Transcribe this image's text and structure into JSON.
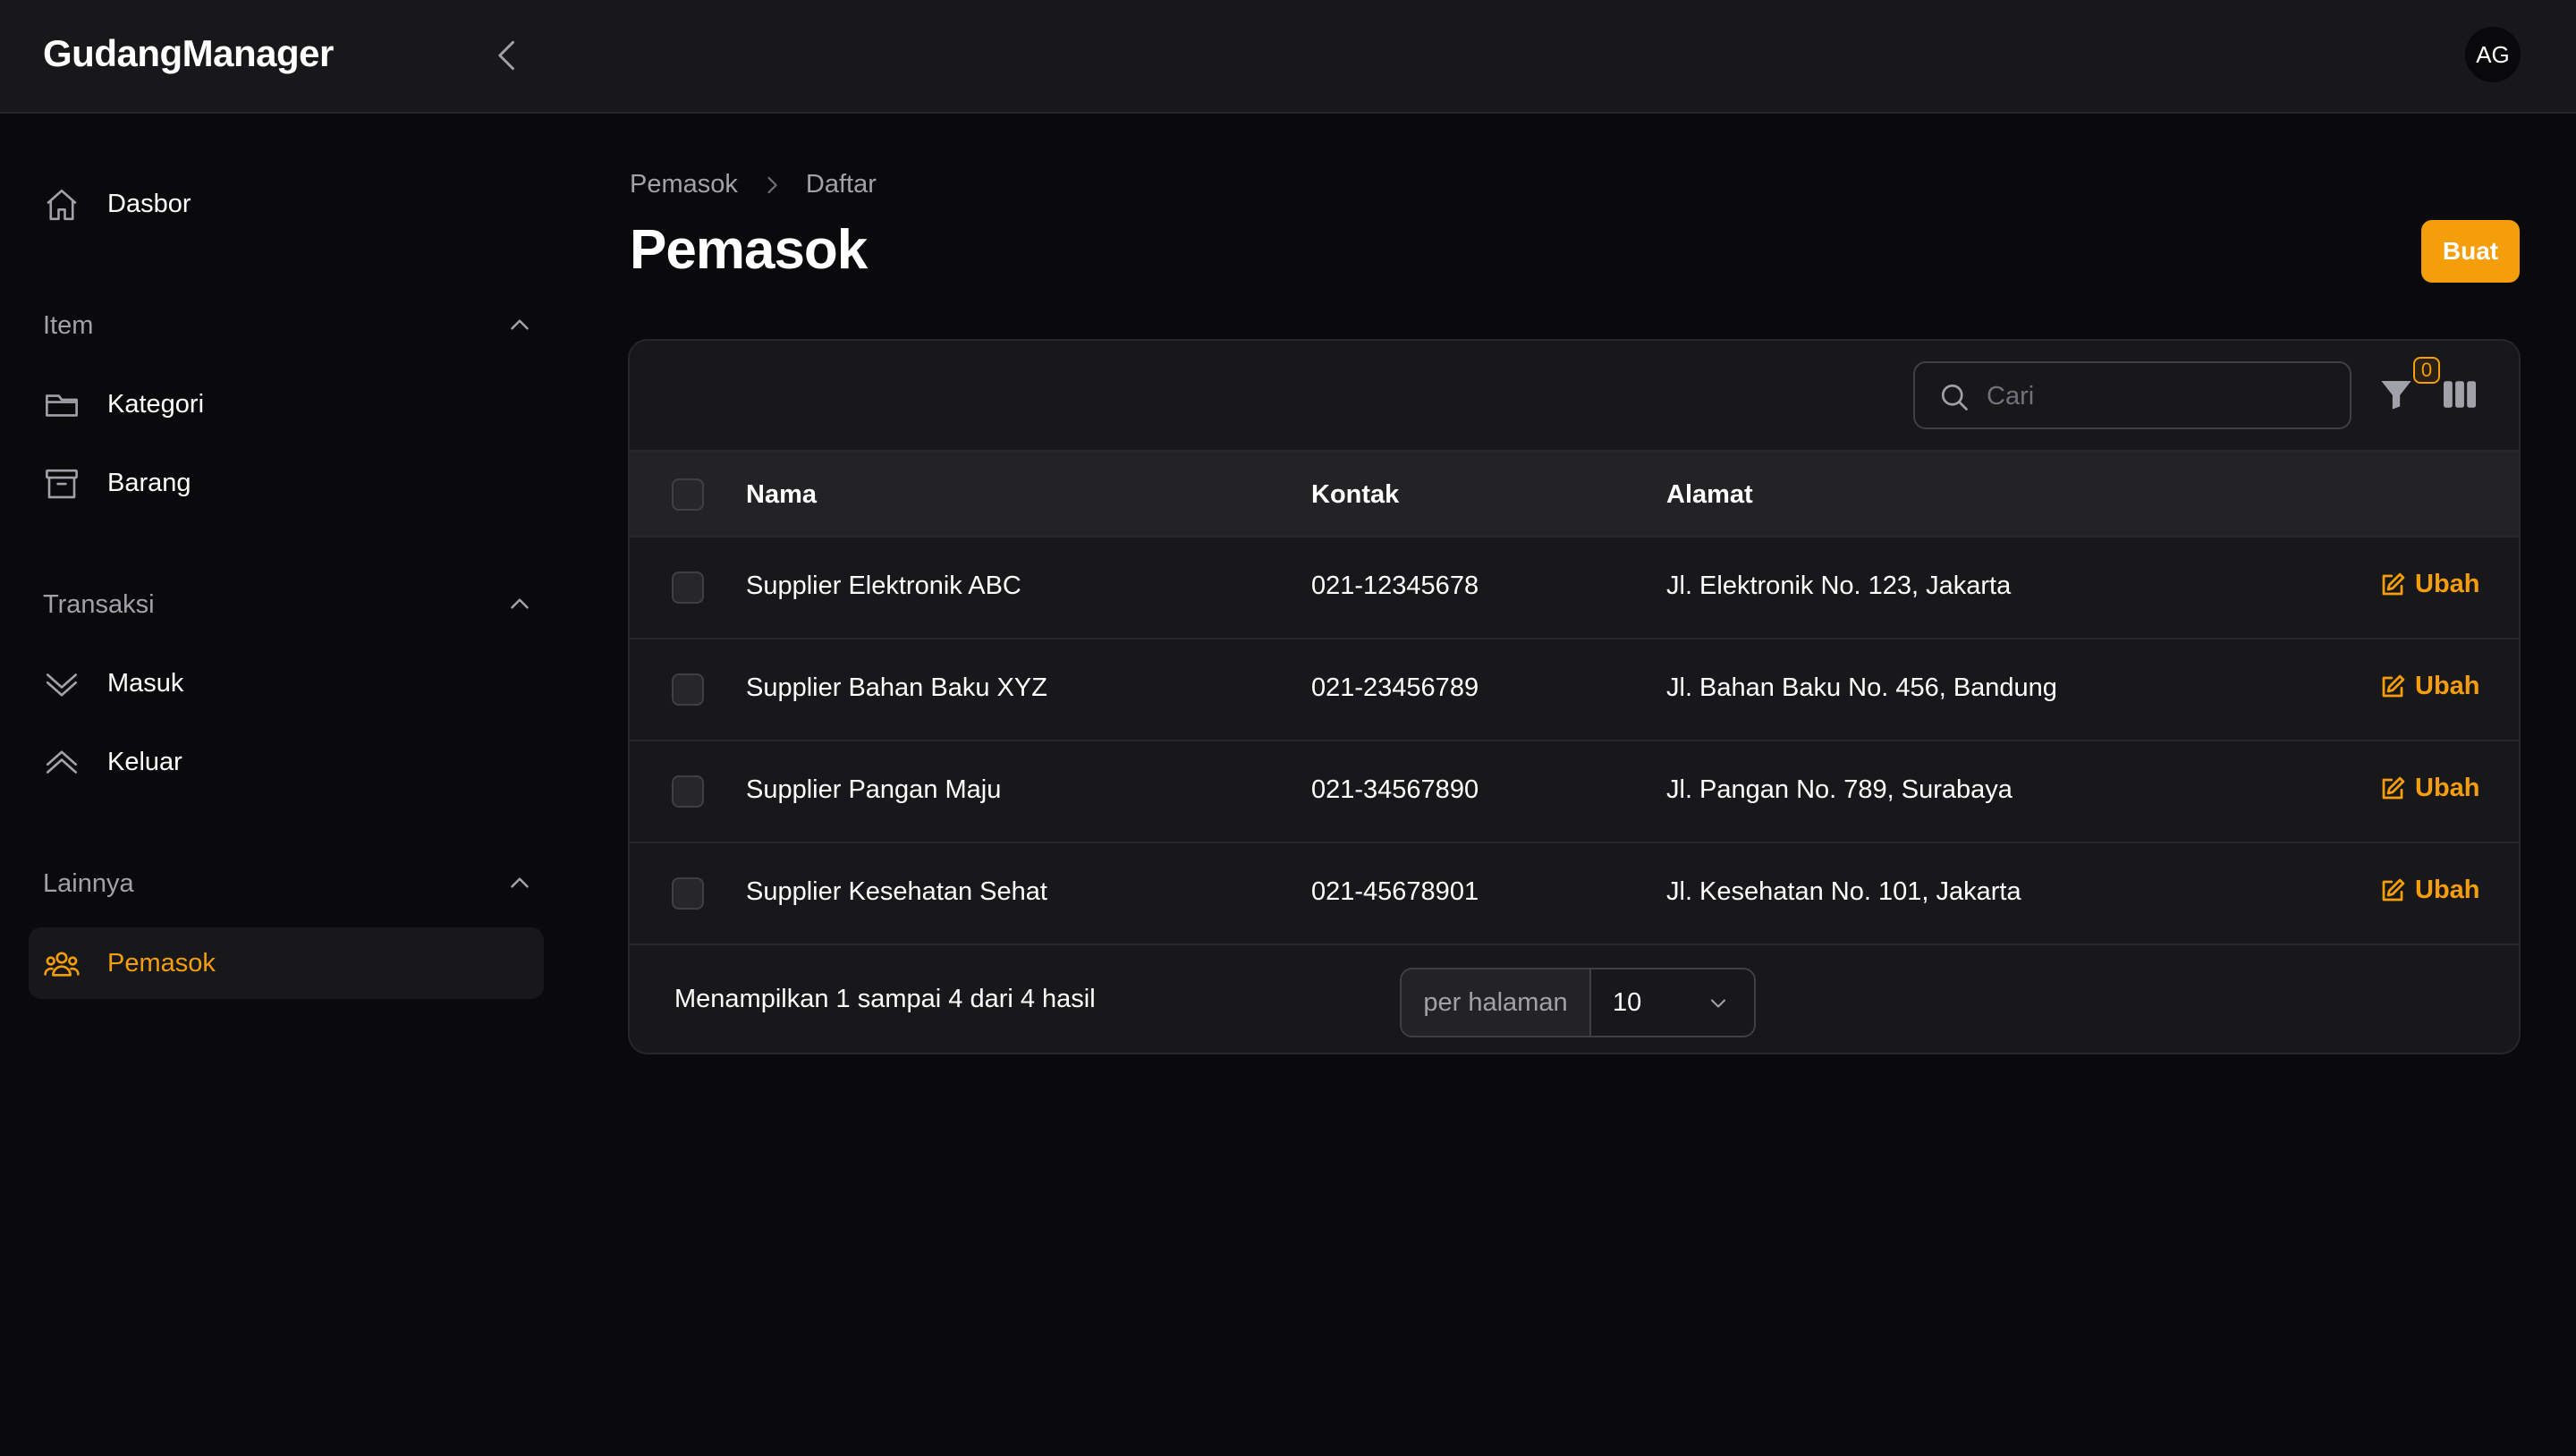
{
  "app": {
    "brand": "GudangManager",
    "avatar_initials": "AG"
  },
  "sidebar": {
    "dashboard": "Dasbor",
    "groups": [
      {
        "label": "Item",
        "items": [
          "Kategori",
          "Barang"
        ]
      },
      {
        "label": "Transaksi",
        "items": [
          "Masuk",
          "Keluar"
        ]
      },
      {
        "label": "Lainnya",
        "items": [
          "Pemasok"
        ]
      }
    ],
    "active_item": "Pemasok"
  },
  "header": {
    "breadcrumb": [
      "Pemasok",
      "Daftar"
    ],
    "title": "Pemasok",
    "create_label": "Buat"
  },
  "toolbar": {
    "search_placeholder": "Cari",
    "filter_count": "0"
  },
  "table": {
    "columns": [
      "Nama",
      "Kontak",
      "Alamat"
    ],
    "rows": [
      {
        "name": "Supplier Elektronik ABC",
        "contact": "021-12345678",
        "address": "Jl. Elektronik No. 123, Jakarta",
        "action": "Ubah"
      },
      {
        "name": "Supplier Bahan Baku XYZ",
        "contact": "021-23456789",
        "address": "Jl. Bahan Baku No. 456, Bandung",
        "action": "Ubah"
      },
      {
        "name": "Supplier Pangan Maju",
        "contact": "021-34567890",
        "address": "Jl. Pangan No. 789, Surabaya",
        "action": "Ubah"
      },
      {
        "name": "Supplier Kesehatan Sehat",
        "contact": "021-45678901",
        "address": "Jl. Kesehatan No. 101, Jakarta",
        "action": "Ubah"
      }
    ]
  },
  "pagination": {
    "summary": "Menampilkan 1 sampai 4 dari 4 hasil",
    "per_page_label": "per halaman",
    "per_page_value": "10"
  },
  "colors": {
    "accent": "#f59e0b",
    "background": "#0a0a0c",
    "surface": "#18181b"
  }
}
